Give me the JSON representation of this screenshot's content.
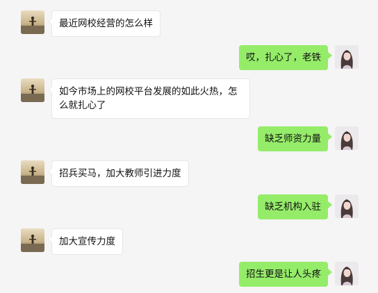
{
  "colors": {
    "background": "#f5f5f5",
    "incoming_bubble": "#ffffff",
    "outgoing_bubble": "#95ec69"
  },
  "messages": [
    {
      "side": "left",
      "text": "最近网校经营的怎么样",
      "avatar": "sunset-silhouette-avatar"
    },
    {
      "side": "right",
      "text": "哎，扎心了，老铁",
      "avatar": "long-hair-girl-avatar"
    },
    {
      "side": "left",
      "text": "如今市场上的网校平台发展的如此火热，怎么就扎心了",
      "avatar": "sunset-silhouette-avatar"
    },
    {
      "side": "right",
      "text": "缺乏师资力量",
      "avatar": "long-hair-girl-avatar"
    },
    {
      "side": "left",
      "text": "招兵买马，加大教师引进力度",
      "avatar": "sunset-silhouette-avatar"
    },
    {
      "side": "right",
      "text": "缺乏机构入驻",
      "avatar": "long-hair-girl-avatar"
    },
    {
      "side": "left",
      "text": "加大宣传力度",
      "avatar": "sunset-silhouette-avatar"
    },
    {
      "side": "right",
      "text": "招生更是让人头疼",
      "avatar": "long-hair-girl-avatar"
    }
  ]
}
